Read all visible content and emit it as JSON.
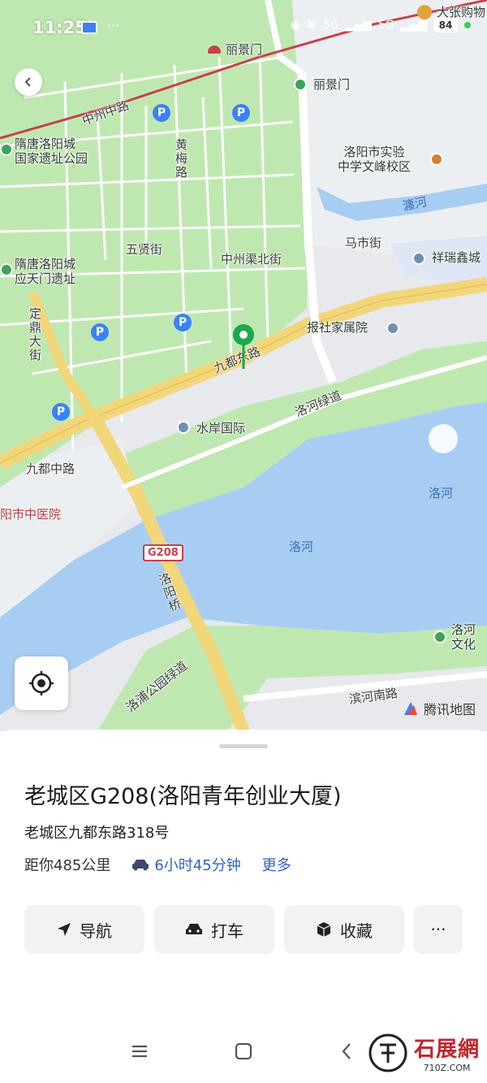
{
  "status_bar": {
    "time": "11:25",
    "network_1": "5G",
    "network_2": "5G",
    "battery": "84"
  },
  "map": {
    "labels": {
      "lijingmen_station": "丽景门",
      "lijingmen_poi": "丽景门",
      "zhongzhou_zhonglu": "中州中路",
      "suitang_site": "隋唐洛阳城\n国家遗址公园",
      "huangmei_lu": "黄梅路",
      "school": "洛阳市实验\n中学文峰校区",
      "chan_river": "瀍河",
      "wuxian_jie": "五贤街",
      "mashi_jie": "马市街",
      "xiangruixin": "祥瑞鑫城",
      "yingtianmen": "隋唐洛阳城\n应天门遗址",
      "zhongzhouqu_beijie": "中州渠北街",
      "dingding_dajie": "定鼎大街",
      "baoshe": "报社家属院",
      "jiudu_donglu": "九都东路",
      "luohe_lvdao": "洛河绿道",
      "shuian_guoji": "水岸国际",
      "jiudu_zhonglu": "九都中路",
      "hospital": "阳市中医院",
      "luohe_east": "洛河",
      "luohe_center": "洛河",
      "g208": "G208",
      "luoyang_qiao": "洛阳桥",
      "luohe_culture": "洛河\n文化",
      "luopu_lvdao": "洛浦公园绿道",
      "binhe_nanlu": "滨河南路",
      "shop": "大张购物"
    },
    "attribution": "腾讯地图",
    "colors": {
      "green": "#bfe8b1",
      "water": "#a7cdf3",
      "road": "#f2d67a",
      "roadwhite": "#ffffff",
      "rail": "#c9414a",
      "marker": "#1aa84c"
    }
  },
  "sheet": {
    "title": "老城区G208(洛阳青年创业大厦)",
    "address": "老城区九都东路318号",
    "distance": "距你485公里",
    "drive_time": "6小时45分钟",
    "more": "更多",
    "buttons": {
      "navigate": "导航",
      "taxi": "打车",
      "favorite": "收藏",
      "more": "···"
    }
  },
  "watermark": {
    "brand": "石展網",
    "url": "710Z.COM"
  }
}
